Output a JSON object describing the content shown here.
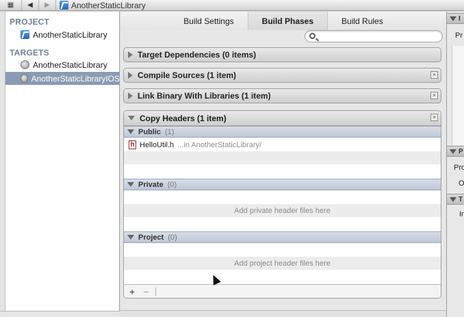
{
  "jumpbar": {
    "crumb": "AnotherStaticLibrary"
  },
  "navigator": {
    "project_header": "PROJECT",
    "project_item": "AnotherStaticLibrary",
    "targets_header": "TARGETS",
    "targets": [
      {
        "label": "AnotherStaticLibrary",
        "selected": false
      },
      {
        "label": "AnotherStaticLibraryIOS",
        "selected": true
      }
    ]
  },
  "tabs": [
    {
      "label": "Build Settings",
      "active": false
    },
    {
      "label": "Build Phases",
      "active": true
    },
    {
      "label": "Build Rules",
      "active": false
    }
  ],
  "search": {
    "placeholder": "",
    "value": ""
  },
  "phases": [
    {
      "title": "Target Dependencies (0 items)",
      "expanded": false,
      "closable": false
    },
    {
      "title": "Compile Sources (1 item)",
      "expanded": false,
      "closable": true
    },
    {
      "title": "Link Binary With Libraries (1 item)",
      "expanded": false,
      "closable": true
    }
  ],
  "copy_headers": {
    "title": "Copy Headers (1 item)",
    "public": {
      "label": "Public",
      "count": "(1)",
      "files": [
        {
          "icon": "header-file-icon",
          "glyph": "h",
          "name": "HelloUtil.h",
          "location": "...in AnotherStaticLibrary/"
        }
      ]
    },
    "private": {
      "label": "Private",
      "count": "(0)",
      "placeholder": "Add private header files here"
    },
    "project": {
      "label": "Project",
      "count": "(0)",
      "placeholder": "Add project header files here"
    },
    "add_label": "+",
    "remove_label": "−"
  },
  "utility": {
    "bar1": "I",
    "text1": "Pr",
    "bar2": "P",
    "text2": "Pro",
    "text3": "O",
    "bar3": "T",
    "text4": "In"
  }
}
